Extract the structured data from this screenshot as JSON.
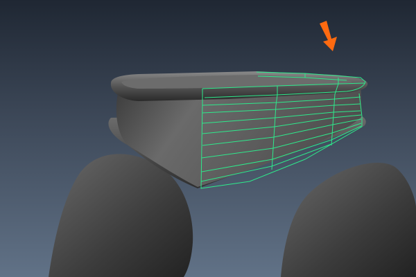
{
  "viewport": {
    "background_top": "#1f2733",
    "background_bottom": "#617287"
  },
  "mesh": {
    "selection_wire_color": "#2eea8c",
    "shading_color": "#5a5a5a"
  },
  "annotation": {
    "arrow_color": "#ff6a10",
    "icon": "arrow-down-icon"
  }
}
